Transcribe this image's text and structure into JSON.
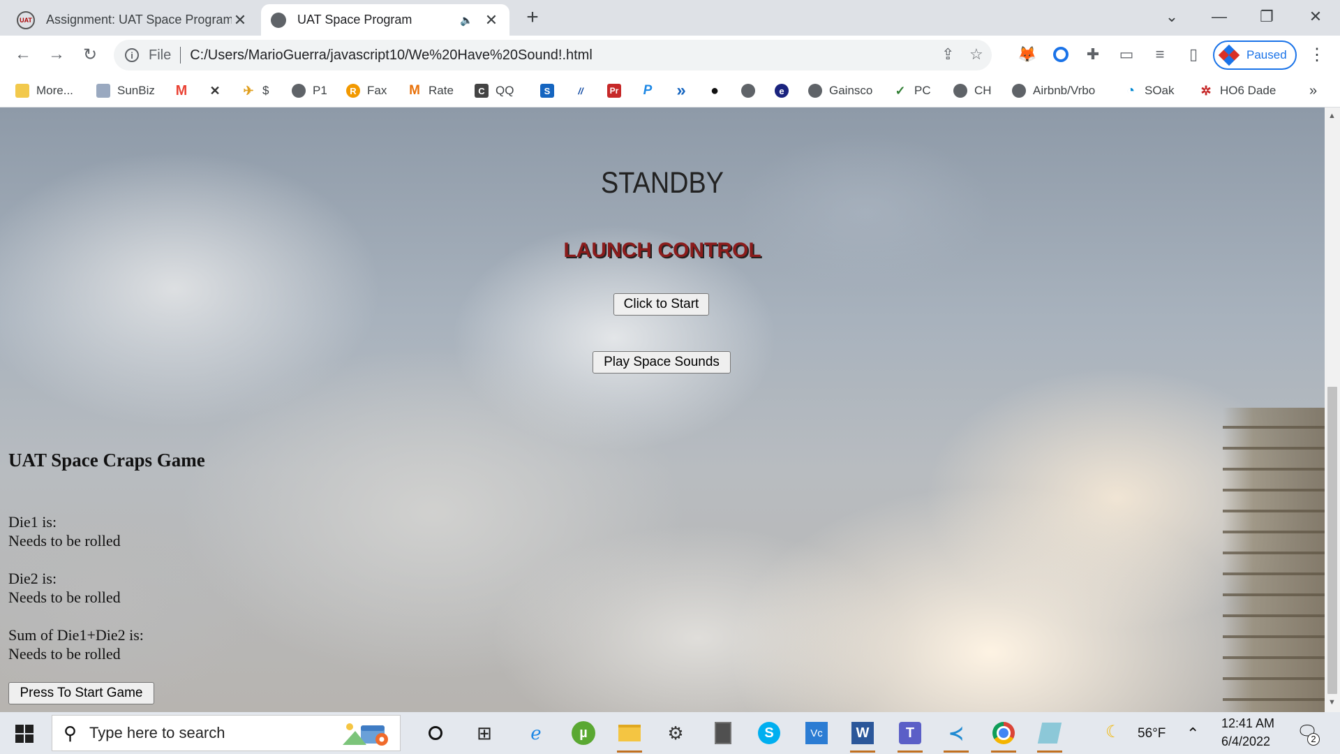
{
  "tabs": [
    {
      "title": "Assignment: UAT Space Program",
      "close": "✕"
    },
    {
      "title": "UAT Space Program",
      "close": "✕",
      "speaker": "🔈"
    }
  ],
  "new_tab": "+",
  "window_controls": {
    "tab_search": "⌄",
    "minimize": "—",
    "restore": "❐",
    "close": "✕"
  },
  "toolbar": {
    "back": "←",
    "forward": "→",
    "reload": "↻",
    "scheme": "File",
    "url": "C:/Users/MarioGuerra/javascript10/We%20Have%20Sound!.html",
    "share_icon": "⇪",
    "star_icon": "☆",
    "profile_label": "Paused",
    "menu": "⋮"
  },
  "bookmarks": [
    {
      "label": "More...",
      "icon": "folder-icon",
      "color": "#f2c94c"
    },
    {
      "label": "SunBiz",
      "icon": "sunbiz-icon",
      "color": "#9aa9c0"
    },
    {
      "label": "",
      "icon": "gmail-icon",
      "glyph": "M",
      "color": "#ea4335"
    },
    {
      "label": "",
      "icon": "x-icon",
      "glyph": "✕",
      "color": "#333333"
    },
    {
      "label": "$",
      "icon": "money-icon",
      "color": "#e0a020"
    },
    {
      "label": "P1",
      "icon": "globe-icon",
      "color": "#5f6368"
    },
    {
      "label": "Fax",
      "icon": "fax-icon",
      "glyph": "R",
      "color": "#f29900"
    },
    {
      "label": "Rate",
      "icon": "rate-icon",
      "glyph": "M",
      "color": "#e8710a"
    },
    {
      "label": "QQ",
      "icon": "qq-icon",
      "glyph": "C",
      "color": "#444444"
    },
    {
      "label": "",
      "icon": "s-icon",
      "glyph": "S",
      "color": "#1565c0"
    },
    {
      "label": "",
      "icon": "slash-icon",
      "glyph": "//",
      "color": "#0d47a1"
    },
    {
      "label": "",
      "icon": "pr-icon",
      "glyph": "Pr",
      "color": "#c62828"
    },
    {
      "label": "",
      "icon": "p-icon",
      "glyph": "P",
      "color": "#1e88e5"
    },
    {
      "label": "",
      "icon": "chevron-icon",
      "glyph": "»",
      "color": "#1565c0"
    },
    {
      "label": "",
      "icon": "ball-icon",
      "glyph": "●",
      "color": "#111111"
    },
    {
      "label": "",
      "icon": "globe-icon",
      "color": "#5f6368"
    },
    {
      "label": "",
      "icon": "e-icon",
      "glyph": "e",
      "color": "#1a237e"
    },
    {
      "label": "Gainsco",
      "icon": "globe-icon",
      "color": "#5f6368"
    },
    {
      "label": "PC",
      "icon": "pc-icon",
      "glyph": "✓",
      "color": "#2e7d32"
    },
    {
      "label": "CH",
      "icon": "globe-icon",
      "color": "#5f6368"
    },
    {
      "label": "Airbnb/Vrbo",
      "icon": "globe-icon",
      "color": "#5f6368"
    },
    {
      "label": "SOak",
      "icon": "soak-icon",
      "glyph": "◔",
      "color": "#0288d1"
    },
    {
      "label": "HO6 Dade",
      "icon": "ho6-icon",
      "glyph": "✲",
      "color": "#c62828"
    }
  ],
  "bookmarks_overflow": "»",
  "page": {
    "heading": "STANDBY",
    "subheading": "LAUNCH CONTROL",
    "start_button": "Click to Start",
    "sounds_button": "Play Space Sounds",
    "game": {
      "title": "UAT Space Craps Game",
      "die1_label": "Die1 is:",
      "die1_value": "Needs to be rolled",
      "die2_label": "Die2 is:",
      "die2_value": "Needs to be rolled",
      "sum_label": "Sum of Die1+Die2 is:",
      "sum_value": "Needs to be rolled",
      "start_button": "Press To Start Game"
    }
  },
  "taskbar": {
    "search_placeholder": "Type here to search",
    "weather": "56°F",
    "time": "12:41 AM",
    "date": "6/4/2022",
    "notifications": "2"
  }
}
